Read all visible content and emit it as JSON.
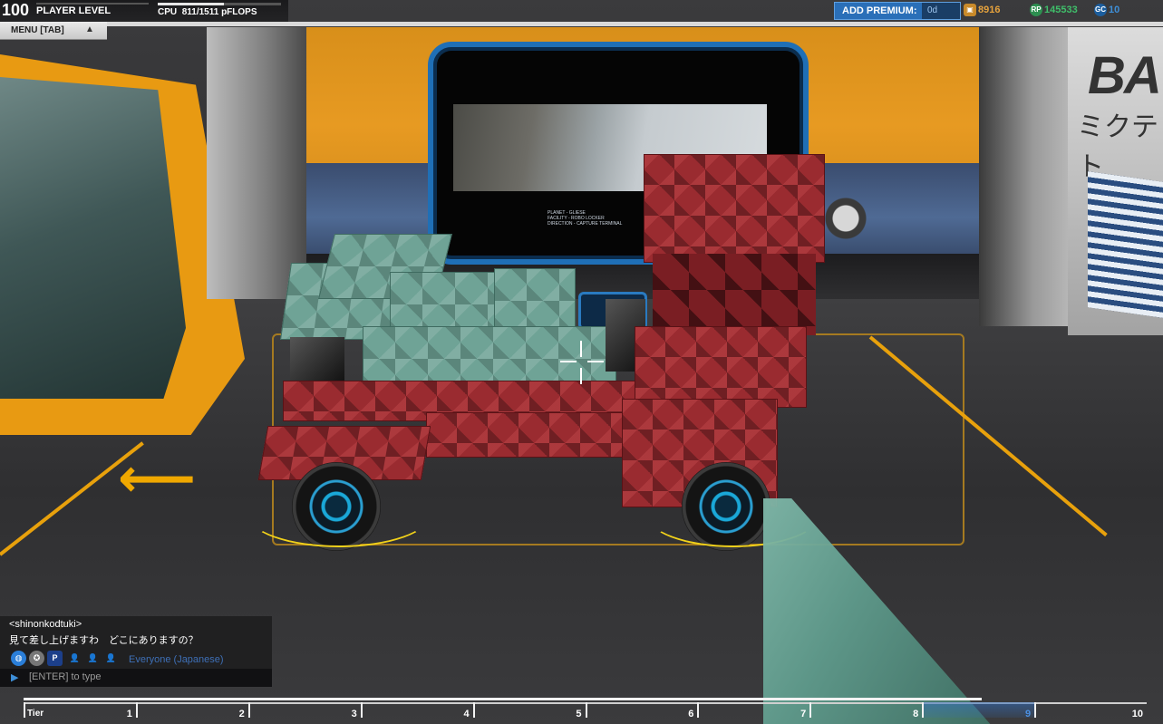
{
  "hud": {
    "player_level": "100",
    "player_level_label": "PLAYER LEVEL",
    "cpu_label": "CPU",
    "cpu_value": "811/1511 pFLOPS",
    "cpu_fraction": 0.537,
    "menu_label": "MENU [TAB]",
    "add_premium_label": "ADD PREMIUM:",
    "premium_days": "0d",
    "robits": "8916",
    "rp_label": "RP",
    "rp": "145533",
    "gc_label": "GC",
    "gc": "10"
  },
  "scene": {
    "brand_text": "BA",
    "brand_subtext": "ミクテト",
    "screen_lines": [
      "PLANET - GLIESE",
      "FACILITY - ROBO LOCKER",
      "DIRECTION - CAPTURE TERMINAL"
    ]
  },
  "chat": {
    "username": "<shinonkodtuki>",
    "message": "見て差し上げますわ　どこにありますの？",
    "channel_icons": [
      "globe-icon",
      "accessibility-icon",
      "party-icon",
      "user-1-icon",
      "user-2-icon",
      "user-3-icon"
    ],
    "party_letter": "P",
    "channel": "Everyone (Japanese)",
    "input_placeholder": "[ENTER] to type"
  },
  "tier_bar": {
    "label": "Tier",
    "progress": 0.853,
    "active_tier": "9",
    "tiers": [
      "1",
      "2",
      "3",
      "4",
      "5",
      "6",
      "7",
      "8",
      "9",
      "10"
    ]
  },
  "colors": {
    "premium_blue": "#2a6fb8",
    "robits_gold": "#e6a23c",
    "rp_green": "#3fbf6a",
    "gc_blue": "#3e8fd8",
    "accent_orange": "#e8a10c"
  }
}
